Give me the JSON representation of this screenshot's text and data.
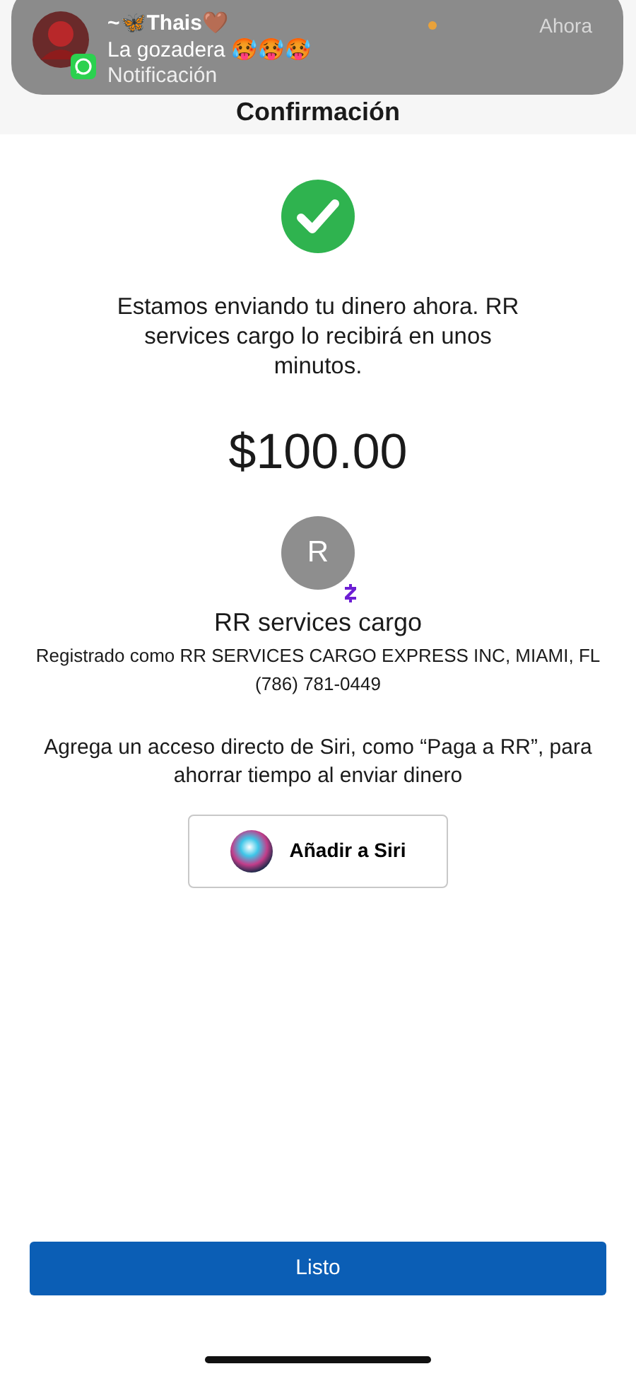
{
  "notification": {
    "sender": "~🦋Thais🤎",
    "message": "La gozadera 🥵🥵🥵",
    "subtitle": "Notificación",
    "time": "Ahora"
  },
  "header": {
    "title": "Confirmación"
  },
  "confirmation": {
    "message": "Estamos enviando tu dinero ahora. RR services cargo lo recibirá en unos minutos.",
    "amount": "$100.00"
  },
  "recipient": {
    "initial": "R",
    "name": "RR services cargo",
    "registered": "Registrado como RR SERVICES CARGO EXPRESS INC, MIAMI, FL",
    "phone": "(786) 781-0449"
  },
  "siri": {
    "text": "Agrega un acceso directo de Siri, como “Paga a RR”, para ahorrar tiempo al enviar dinero",
    "button": "Añadir a Siri"
  },
  "done_button": "Listo"
}
